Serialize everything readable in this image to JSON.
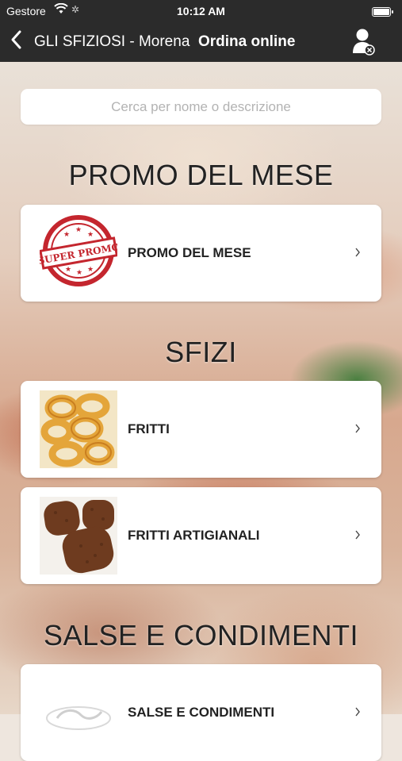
{
  "status_bar": {
    "carrier": "Gestore",
    "time": "10:12 AM"
  },
  "nav": {
    "title_store": "GLI SFIZIOSI - Morena",
    "title_page": "Ordina online",
    "back_icon": "chevron-left-icon",
    "account_icon": "user-logout-icon"
  },
  "search": {
    "placeholder": "Cerca per nome o descrizione",
    "value": ""
  },
  "sections": [
    {
      "title": "PROMO DEL MESE",
      "items": [
        {
          "label": "PROMO DEL MESE",
          "image": "super-promo-stamp",
          "stamp_text": "SUPER PROMO"
        }
      ]
    },
    {
      "title": "SFIZI",
      "items": [
        {
          "label": "FRITTI",
          "image": "onion-rings-photo"
        },
        {
          "label": "FRITTI ARTIGIANALI",
          "image": "croquettes-photo"
        }
      ]
    },
    {
      "title": "SALSE E CONDIMENTI",
      "items": [
        {
          "label": "SALSE E CONDIMENTI",
          "image": "gli-sfiziosi-logo"
        }
      ]
    }
  ],
  "colors": {
    "header_bg": "#2b2b2b",
    "promo_red": "#c4262e",
    "card_bg": "#ffffff"
  }
}
